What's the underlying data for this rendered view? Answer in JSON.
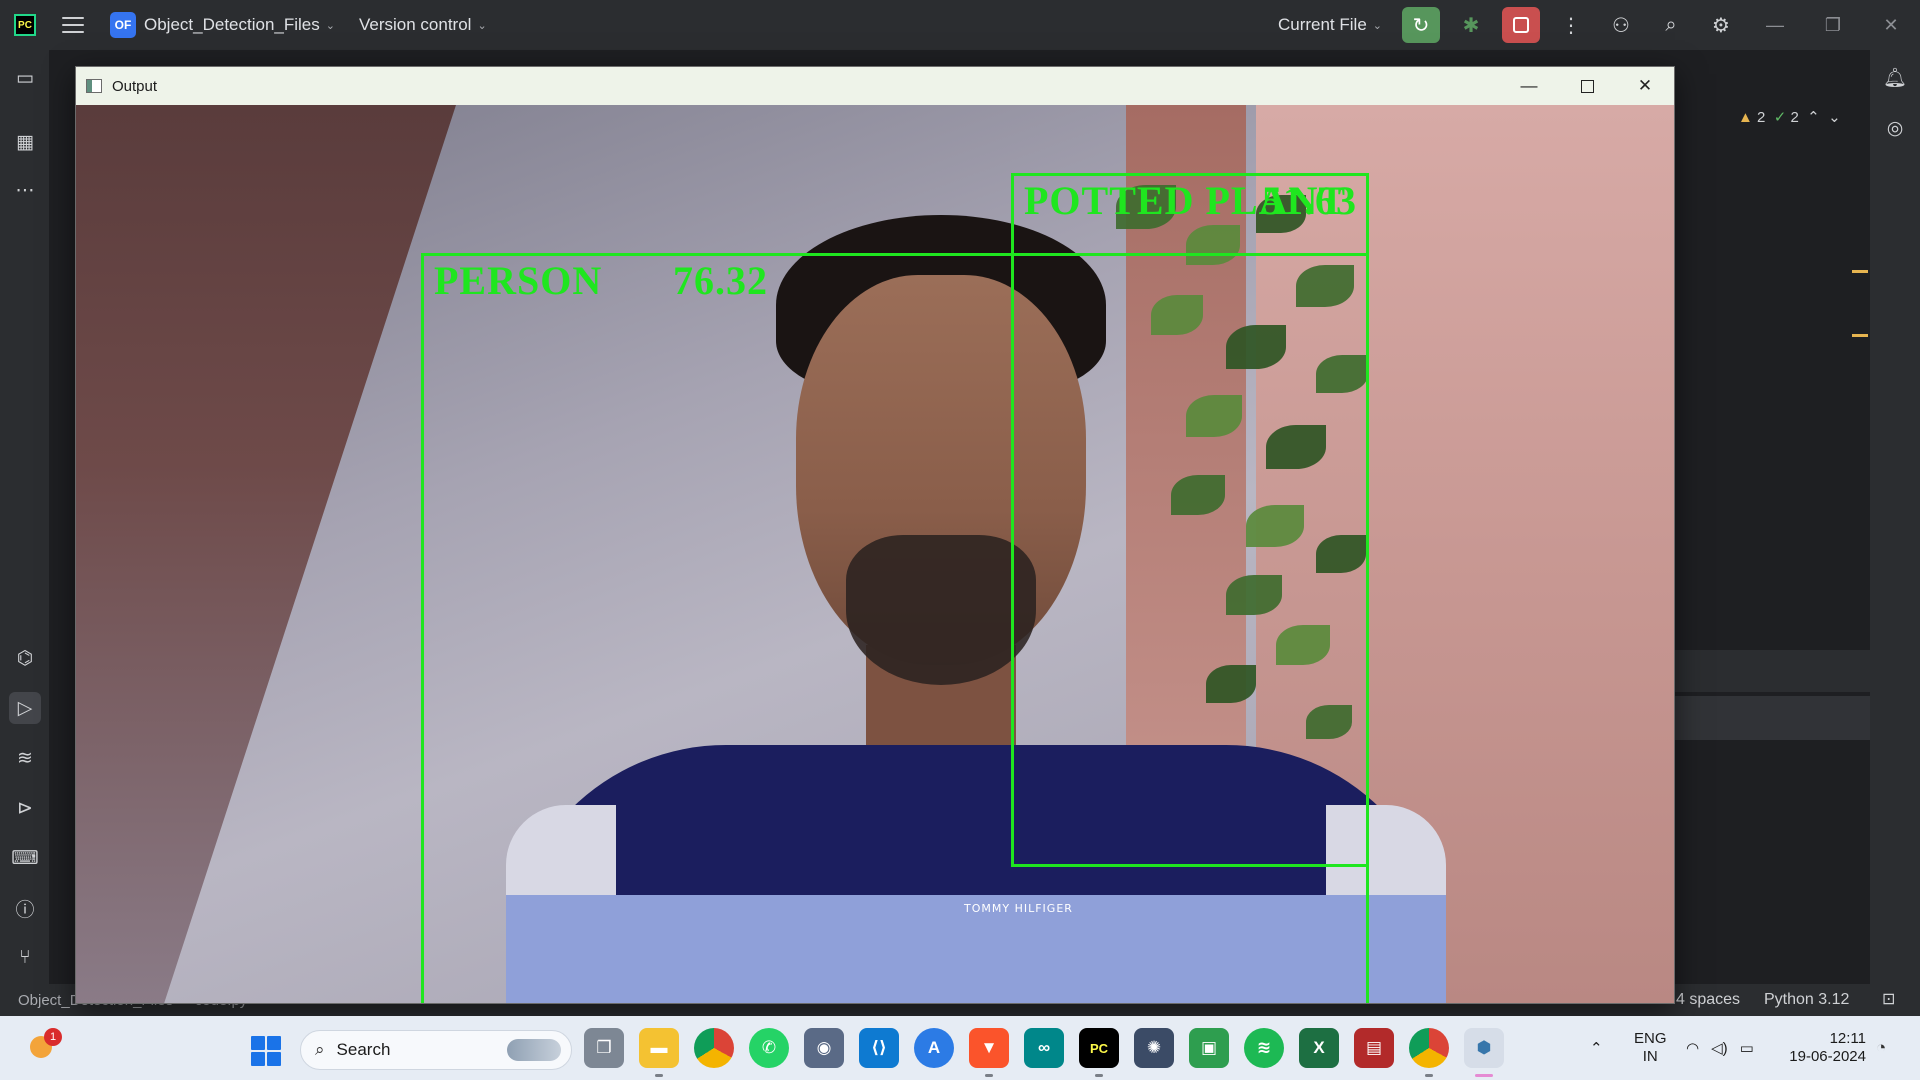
{
  "ide": {
    "project_badge": "OF",
    "project_name": "Object_Detection_Files",
    "vcs_label": "Version control",
    "run_config": "Current File",
    "warnings_count": "2",
    "ok_count": "2",
    "status_path_project": "Object_Detection_Files",
    "status_path_file": "code.py",
    "status_indent": "4 spaces",
    "status_python": "Python 3.12"
  },
  "output_window": {
    "title": "Output"
  },
  "detections": [
    {
      "label": "PERSON",
      "confidence": "76.32"
    },
    {
      "label": "POTTED PLANT",
      "confidence": "51.63"
    }
  ],
  "taskbar": {
    "weather_badge": "1",
    "search_placeholder": "Search",
    "lang_line1": "ENG",
    "lang_line2": "IN",
    "time": "12:11",
    "date": "19-06-2024",
    "apps": [
      "task-view",
      "file-explorer",
      "chrome",
      "whatsapp",
      "camera",
      "vscode",
      "app-store",
      "brave",
      "arduino",
      "pycharm",
      "beetle",
      "gallery",
      "spotify",
      "excel",
      "winrar",
      "chrome-profile",
      "python"
    ]
  },
  "icons": {
    "search": "search-icon",
    "settings": "gear-icon",
    "notifications": "bell-icon"
  },
  "colors": {
    "detection_box": "#1fe61f",
    "run_button": "#57965c",
    "stop_button": "#c94f4f",
    "project_badge": "#3574f0"
  }
}
